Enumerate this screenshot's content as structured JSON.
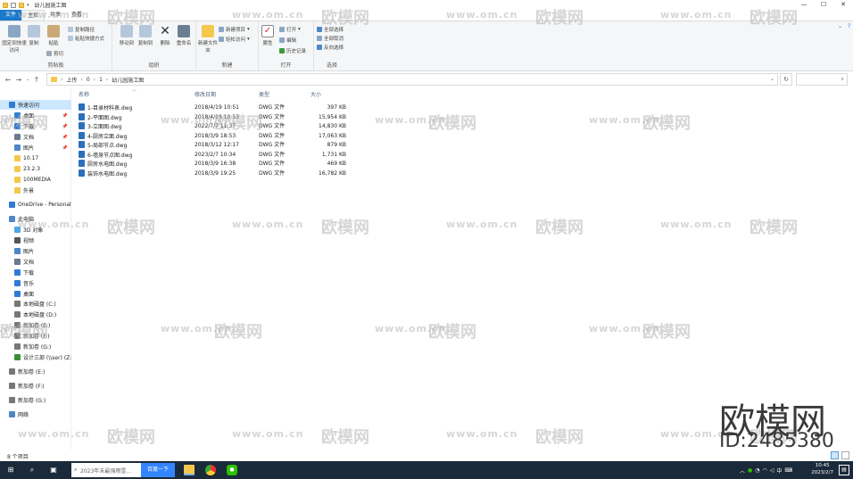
{
  "titlebar": {
    "title": "幼儿园施工图",
    "min": "—",
    "max": "☐",
    "close": "✕"
  },
  "tabs": [
    {
      "label": "文件"
    },
    {
      "label": "主页"
    },
    {
      "label": "共享"
    },
    {
      "label": "查看"
    }
  ],
  "ribbon": {
    "pin_quick": "固定到快速访问",
    "copy": "复制",
    "paste": "粘贴",
    "copy_path": "复制路径",
    "paste_shortcut": "粘贴快捷方式",
    "cut": "剪切",
    "clipboard_group": "剪贴板",
    "move_to": "移动到",
    "copy_to": "复制到",
    "delete": "删除",
    "rename": "重命名",
    "organize_group": "组织",
    "new_folder": "新建文件夹",
    "new_item": "新建项目",
    "easy_access": "轻松访问",
    "new_group": "新建",
    "properties": "属性",
    "open": "打开",
    "edit": "编辑",
    "history": "历史记录",
    "open_group": "打开",
    "select_all": "全部选择",
    "select_none": "全部取消",
    "invert": "反向选择",
    "select_group": "选择"
  },
  "address": {
    "crumbs": [
      "上传",
      "0",
      "1",
      "幼儿园施工图"
    ],
    "search_icon": "search-icon"
  },
  "nav": {
    "items": [
      {
        "label": "快速访问",
        "icon": "star-icon",
        "color": "#2f7bd6",
        "indent": 0,
        "selected": true
      },
      {
        "label": "桌面",
        "icon": "desktop-icon",
        "color": "#2f7bd6",
        "indent": 1,
        "pin": true
      },
      {
        "label": "下载",
        "icon": "download-icon",
        "color": "#2f7bd6",
        "indent": 1,
        "pin": true
      },
      {
        "label": "文档",
        "icon": "document-icon",
        "color": "#6a7b8c",
        "indent": 1,
        "pin": true
      },
      {
        "label": "图片",
        "icon": "picture-icon",
        "color": "#4d87c8",
        "indent": 1,
        "pin": true
      },
      {
        "label": "10.17",
        "icon": "folder-icon",
        "color": "#f5c84c",
        "indent": 1
      },
      {
        "label": "23.2.3",
        "icon": "folder-icon",
        "color": "#f5c84c",
        "indent": 1
      },
      {
        "label": "100MEDIA",
        "icon": "folder-icon",
        "color": "#f5c84c",
        "indent": 1
      },
      {
        "label": "外景",
        "icon": "folder-icon",
        "color": "#f5c84c",
        "indent": 1
      },
      {
        "label": "OneDrive - Personal",
        "icon": "cloud-icon",
        "color": "#2f7bd6",
        "indent": 0
      },
      {
        "label": "此电脑",
        "icon": "computer-icon",
        "color": "#4d87c8",
        "indent": 0
      },
      {
        "label": "3D 对象",
        "icon": "3d-icon",
        "color": "#4da6e8",
        "indent": 1
      },
      {
        "label": "视频",
        "icon": "video-icon",
        "color": "#555555",
        "indent": 1
      },
      {
        "label": "图片",
        "icon": "picture-icon",
        "color": "#4d87c8",
        "indent": 1
      },
      {
        "label": "文档",
        "icon": "document-icon",
        "color": "#6a7b8c",
        "indent": 1
      },
      {
        "label": "下载",
        "icon": "download-icon",
        "color": "#2f7bd6",
        "indent": 1
      },
      {
        "label": "音乐",
        "icon": "music-icon",
        "color": "#2f7bd6",
        "indent": 1
      },
      {
        "label": "桌面",
        "icon": "desktop-icon",
        "color": "#2f7bd6",
        "indent": 1
      },
      {
        "label": "本地磁盘 (C:)",
        "icon": "drive-icon",
        "color": "#777777",
        "indent": 1
      },
      {
        "label": "本地磁盘 (D:)",
        "icon": "drive-icon",
        "color": "#777777",
        "indent": 1
      },
      {
        "label": "新加卷 (E:)",
        "icon": "drive-icon",
        "color": "#777777",
        "indent": 1
      },
      {
        "label": "新加卷 (F:)",
        "icon": "drive-icon",
        "color": "#777777",
        "indent": 1
      },
      {
        "label": "新加卷 (G:)",
        "icon": "drive-icon",
        "color": "#777777",
        "indent": 1
      },
      {
        "label": "设计三部 (\\\\ser) (Z:)",
        "icon": "network-drive-icon",
        "color": "#3a8f3a",
        "indent": 1
      },
      {
        "label": "新加卷 (E:)",
        "icon": "drive-icon",
        "color": "#777777",
        "indent": 0
      },
      {
        "label": "新加卷 (F:)",
        "icon": "drive-icon",
        "color": "#777777",
        "indent": 0
      },
      {
        "label": "新加卷 (G:)",
        "icon": "drive-icon",
        "color": "#777777",
        "indent": 0
      },
      {
        "label": "网络",
        "icon": "network-icon",
        "color": "#4d87c8",
        "indent": 0
      }
    ]
  },
  "columns": {
    "name": "名称",
    "modified": "修改日期",
    "type": "类型",
    "size": "大小"
  },
  "files": [
    {
      "name": "1-目录材料表.dwg",
      "modified": "2018/4/19 10:51",
      "type": "DWG 文件",
      "size": "397 KB"
    },
    {
      "name": "2-平面图.dwg",
      "modified": "2018/4/19 10:53",
      "type": "DWG 文件",
      "size": "15,954 KB"
    },
    {
      "name": "3-立面图.dwg",
      "modified": "2022/7/7 11:37",
      "type": "DWG 文件",
      "size": "14,830 KB"
    },
    {
      "name": "4-厨房立面.dwg",
      "modified": "2018/3/9 18:53",
      "type": "DWG 文件",
      "size": "17,063 KB"
    },
    {
      "name": "5-局部节点.dwg",
      "modified": "2018/3/12 12:17",
      "type": "DWG 文件",
      "size": "879 KB"
    },
    {
      "name": "6-墙身节点图.dwg",
      "modified": "2023/2/7 10:34",
      "type": "DWG 文件",
      "size": "1,731 KB"
    },
    {
      "name": "厨房水电图.dwg",
      "modified": "2018/3/9 16:38",
      "type": "DWG 文件",
      "size": "469 KB"
    },
    {
      "name": "装饰水电图.dwg",
      "modified": "2018/3/9 19:25",
      "type": "DWG 文件",
      "size": "16,782 KB"
    }
  ],
  "status": {
    "count": "8 个项目"
  },
  "taskbar": {
    "search_placeholder": "2023年未最强雨雪...",
    "baidu": "百度一下",
    "ime": "中",
    "time": "10:45",
    "date": "2023/2/7"
  },
  "watermark": {
    "url": "www.om.cn",
    "brand": "欧模网",
    "big": "欧模网",
    "id": "ID:2485380"
  }
}
